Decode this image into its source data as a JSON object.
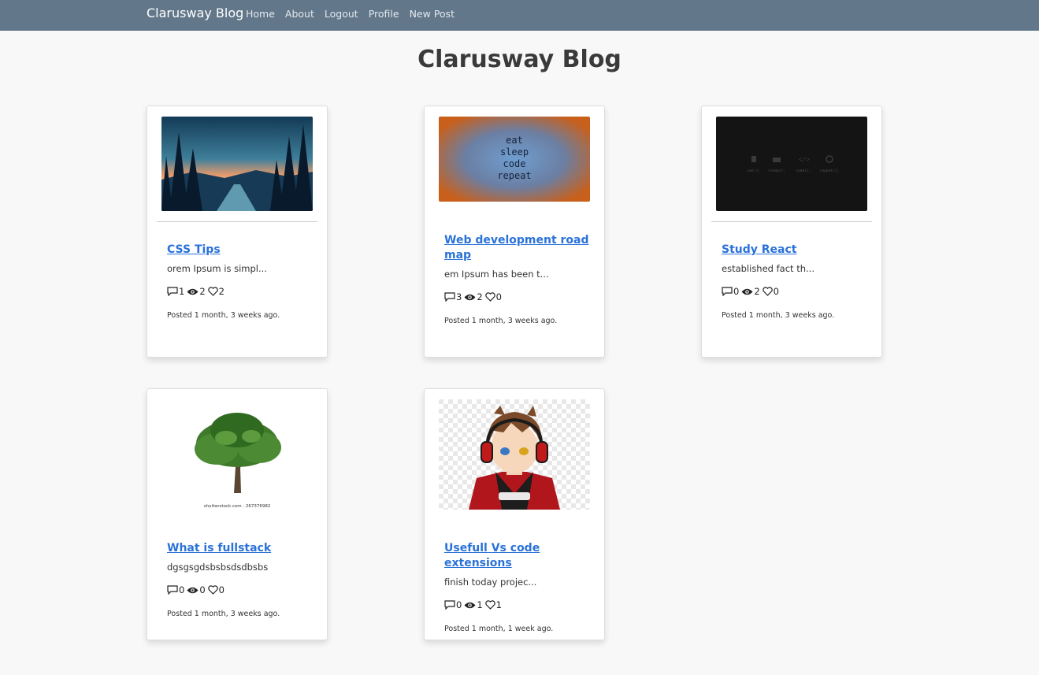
{
  "navbar": {
    "brand": "Clarusway Blog",
    "links": [
      "Home",
      "About",
      "Logout",
      "Profile",
      "New Post"
    ]
  },
  "page": {
    "title": "Clarusway Blog"
  },
  "posts": [
    {
      "title": "CSS Tips",
      "excerpt": "orem Ipsum is simpl...",
      "comments": "1",
      "views": "2",
      "likes": "2",
      "date": "Posted 1 month, 3 weeks ago.",
      "image": "forest-landscape"
    },
    {
      "title": "Web development road map",
      "excerpt": "em Ipsum has been t...",
      "comments": "3",
      "views": "2",
      "likes": "0",
      "date": "Posted 1 month, 3 weeks ago.",
      "image": "eat-sleep-code-repeat",
      "image_text": [
        "eat",
        "sleep",
        "code",
        "repeat"
      ]
    },
    {
      "title": "Study React",
      "excerpt": "established fact th...",
      "comments": "0",
      "views": "2",
      "likes": "0",
      "date": "Posted 1 month, 3 weeks ago.",
      "image": "dark-code-routine",
      "image_text": [
        "eat();",
        "sleep();",
        "code();",
        "repeat();"
      ]
    },
    {
      "title": "What is fullstack",
      "excerpt": "dgsgsgdsbsbsdsdbsbs",
      "comments": "0",
      "views": "0",
      "likes": "0",
      "date": "Posted 1 month, 3 weeks ago.",
      "image": "green-tree",
      "image_text": [
        "shutterstock.com · 267376982"
      ]
    },
    {
      "title": "Usefull Vs code extensions",
      "excerpt": "finish today projec...",
      "comments": "0",
      "views": "1",
      "likes": "1",
      "date": "Posted 1 month, 1 week ago.",
      "image": "anime-gamer-avatar"
    }
  ],
  "icons": {
    "comments": "comment-icon",
    "views": "eye-icon",
    "likes": "heart-icon"
  },
  "colors": {
    "navbar": "#62778a",
    "link": "#2a72d8",
    "background": "#f8f8f8"
  }
}
